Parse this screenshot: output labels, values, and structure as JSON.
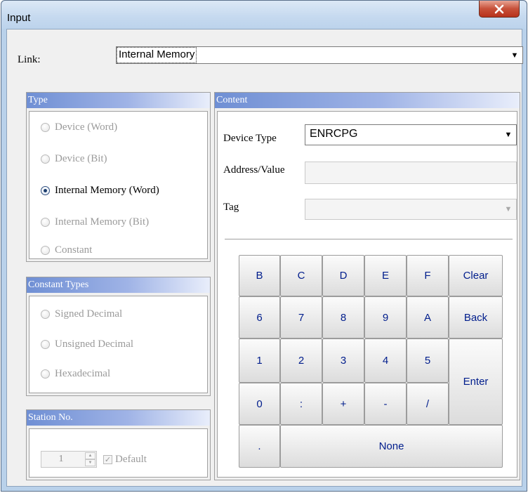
{
  "window": {
    "title": "Input"
  },
  "link": {
    "label": "Link:",
    "value": "Internal Memory"
  },
  "type_group": {
    "title": "Type",
    "options": [
      {
        "label": "Device (Word)",
        "checked": false,
        "enabled": false
      },
      {
        "label": "Device (Bit)",
        "checked": false,
        "enabled": false
      },
      {
        "label": "Internal Memory (Word)",
        "checked": true,
        "enabled": true
      },
      {
        "label": "Internal Memory (Bit)",
        "checked": false,
        "enabled": false
      },
      {
        "label": "Constant",
        "checked": false,
        "enabled": false
      }
    ]
  },
  "constant_types": {
    "title": "Constant Types",
    "options": [
      {
        "label": "Signed Decimal",
        "enabled": false
      },
      {
        "label": "Unsigned Decimal",
        "enabled": false
      },
      {
        "label": "Hexadecimal",
        "enabled": false
      }
    ]
  },
  "station": {
    "title": "Station No.",
    "value": "1",
    "default_label": "Default",
    "default_checked": true
  },
  "content": {
    "title": "Content",
    "device_type_label": "Device Type",
    "device_type_value": "ENRCPG",
    "address_label": "Address/Value",
    "address_value": "",
    "tag_label": "Tag",
    "tag_value": ""
  },
  "keypad": {
    "row1": [
      "B",
      "C",
      "D",
      "E",
      "F"
    ],
    "row2": [
      "6",
      "7",
      "8",
      "9",
      "A"
    ],
    "row3": [
      "1",
      "2",
      "3",
      "4",
      "5"
    ],
    "row4": [
      "0",
      ":",
      "+",
      "-",
      "/"
    ],
    "clear": "Clear",
    "back": "Back",
    "enter": "Enter",
    "dot": ".",
    "none": "None"
  },
  "icons": {
    "close": "close-icon",
    "dropdown": "chevron-down-icon",
    "spin_up": "spin-up-icon",
    "spin_down": "spin-down-icon",
    "check": "check-icon"
  }
}
